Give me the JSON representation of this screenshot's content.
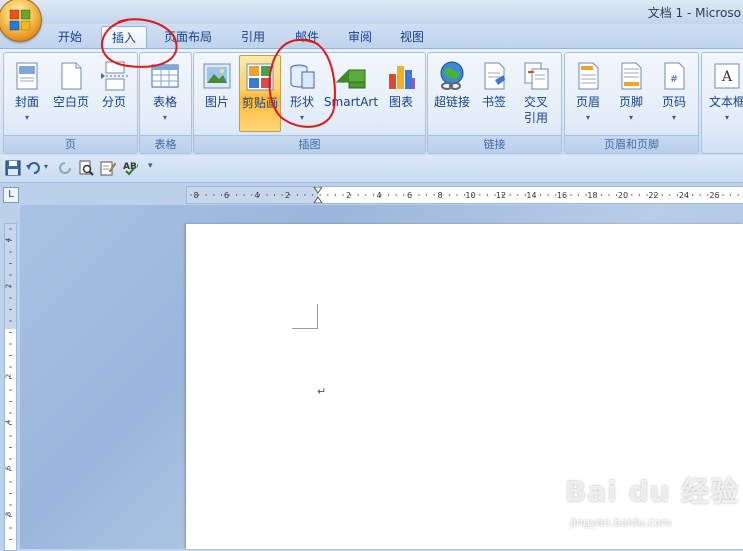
{
  "window": {
    "title": "文档 1 - Microso"
  },
  "tabs": [
    {
      "label": "开始",
      "active": false
    },
    {
      "label": "插入",
      "active": true
    },
    {
      "label": "页面布局",
      "active": false
    },
    {
      "label": "引用",
      "active": false
    },
    {
      "label": "邮件",
      "active": false
    },
    {
      "label": "审阅",
      "active": false
    },
    {
      "label": "视图",
      "active": false
    }
  ],
  "ribbon": {
    "groups": {
      "pages": {
        "label": "页",
        "cover": "封面",
        "blank": "空白页",
        "break": "分页"
      },
      "tables": {
        "label": "表格",
        "table": "表格"
      },
      "illustrations": {
        "label": "插图",
        "picture": "图片",
        "clipart": "剪贴画",
        "shapes": "形状",
        "smartart": "SmartArt",
        "chart": "图表"
      },
      "links": {
        "label": "链接",
        "hyperlink": "超链接",
        "bookmark": "书签",
        "crossref_1": "交叉",
        "crossref_2": "引用"
      },
      "header_footer": {
        "label": "页眉和页脚",
        "header": "页眉",
        "footer": "页脚",
        "pagenum": "页码"
      },
      "text": {
        "textbox": "文本框"
      }
    }
  },
  "rulers": {
    "corner": "L",
    "horizontal_ticks": [
      "8",
      "6",
      "4",
      "2",
      "2",
      "4",
      "6",
      "8",
      "10",
      "12",
      "14",
      "16",
      "18",
      "20",
      "22",
      "24",
      "26"
    ],
    "vertical_ticks": [
      "4",
      "2",
      "2",
      "4",
      "6",
      "8"
    ]
  },
  "document": {
    "paragraph_mark": "↵"
  },
  "watermark": {
    "brand": "Bai du 经验",
    "url": "jingyan.baidu.com"
  },
  "colors": {
    "accent": "#15428b",
    "annotation": "#e01818",
    "highlight": "#ffc848"
  }
}
